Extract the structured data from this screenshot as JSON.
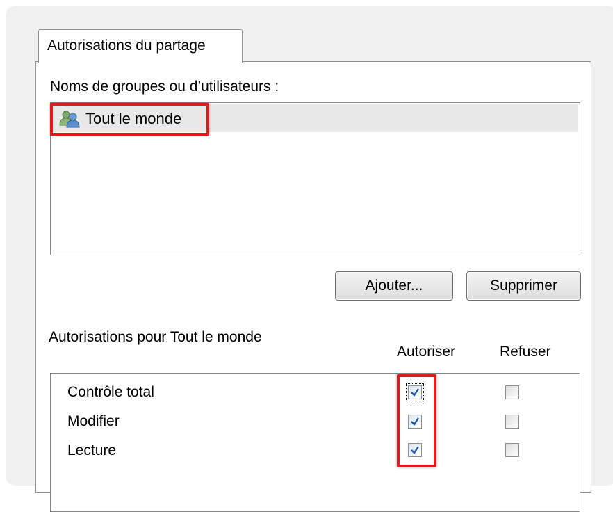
{
  "tab": {
    "label": "Autorisations du partage"
  },
  "groups": {
    "label": "Noms de groupes ou d’utilisateurs :",
    "items": [
      {
        "name": "Tout le monde",
        "icon": "user-group-icon"
      }
    ]
  },
  "buttons": {
    "add": "Ajouter...",
    "remove": "Supprimer"
  },
  "permissions": {
    "label": "Autorisations pour Tout le monde",
    "col_allow": "Autoriser",
    "col_deny": "Refuser",
    "rows": [
      {
        "name": "Contrôle total",
        "allow": true,
        "deny": false
      },
      {
        "name": "Modifier",
        "allow": true,
        "deny": false
      },
      {
        "name": "Lecture",
        "allow": true,
        "deny": false
      }
    ]
  },
  "colors": {
    "highlight": "#e01b1b",
    "check": "#1e5aa8"
  }
}
